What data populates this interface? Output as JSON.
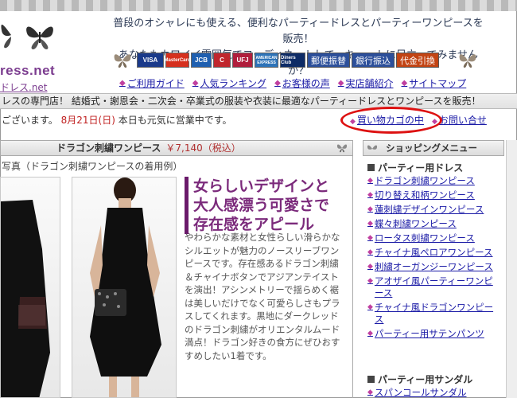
{
  "header": {
    "logo_text": "ress.net",
    "logo_sub": "ドレス.net",
    "line1": "普段のオシャレにも使える、便利なパーティードレスとパーティーワンピースを販売！",
    "line2": "あなたもカワイイ雰囲気でコーディネートして、キュートに目立ってみませんか？"
  },
  "payments": {
    "cards": [
      {
        "label": "VISA",
        "color": "#1a3a8a"
      },
      {
        "label": "MasterCard",
        "color": "#d6301e"
      },
      {
        "label": "JCB",
        "color": "#1f5fb0"
      },
      {
        "label": "C",
        "color": "#c0272d"
      },
      {
        "label": "UFJ",
        "color": "#b01e3c"
      },
      {
        "label": "AMERICAN EXPRESS",
        "color": "#2d73b8"
      },
      {
        "label": "Diners Club",
        "color": "#0d2b66"
      }
    ],
    "methods": [
      {
        "label": "郵便振替",
        "color": "#2c4f9a"
      },
      {
        "label": "銀行振込",
        "color": "#2c4f9a"
      },
      {
        "label": "代金引換",
        "color": "#c24414"
      }
    ]
  },
  "nav": {
    "items": [
      "ご利用ガイド",
      "人気ランキング",
      "お客様の声",
      "実店舗紹介",
      "サイトマップ"
    ]
  },
  "tagline": "レスの専門店！ 結婚式・謝恩会・二次会・卒業式の服装や衣装に最適なパーティードレスとワンピースを販売！",
  "welcome": {
    "prefix": "ございます。",
    "date": "8月21日(日)",
    "suffix": " 本日も元気に営業中です。"
  },
  "topnav2": {
    "cart": "買い物カゴの中",
    "contact": "お問い合せ"
  },
  "product": {
    "title": "ドラゴン刺繍ワンピース",
    "price": "￥7,140（税込）",
    "photo_caption": "写真（ドラゴン刺繍ワンピースの着用例）",
    "headline": "女らしいデザインと大人感漂う可愛さで存在感をアピール",
    "description": "やわらかな素材と女性らしい滑らかなシルエットが魅力のノースリーブワンピースです。存在感あるドラゴン刺繍＆チャイナボタンでアジアンテイストを演出！アシンメトリーで揺らめく裾は美しいだけでなく可愛らしさもプラスしてくれます。黒地にダークレッドのドラゴン刺繍がオリエンタルムード満点！ドラゴン好きの食方にぜひおすすめしたい1着です。"
  },
  "sidebar": {
    "title": "ショッピングメニュー",
    "category1": "パーティー用ドレス",
    "items1": [
      "ドラゴン刺繍ワンピース",
      "切り替え和柄ワンピース",
      "蓮刺繍デザインワンピース",
      "蝶々刺繍ワンピース",
      "ロータス刺繍ワンピース",
      "チャイナ風ペロアワンピース",
      "刺繍オーガンジーワンピース",
      "アオザイ風パーティーワンピース",
      "チャイナ風ドラゴンワンピース",
      "パーティー用サテンパンツ"
    ],
    "category2": "パーティー用サンダル",
    "items2": [
      "スパンコールサンダル"
    ]
  }
}
